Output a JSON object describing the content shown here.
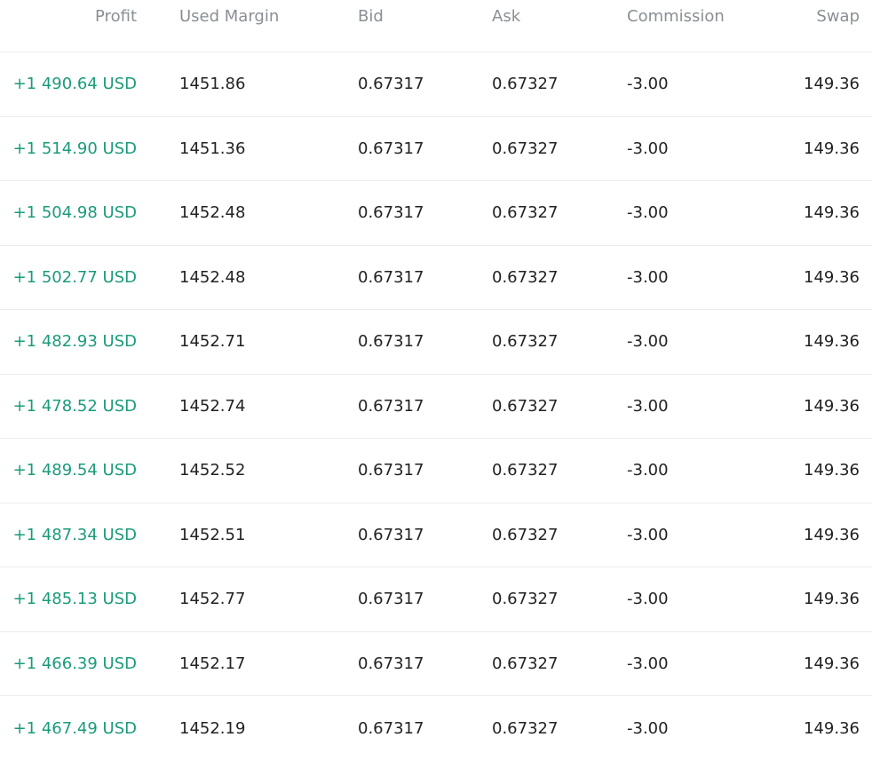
{
  "columns": {
    "profit": "Profit",
    "used_margin": "Used Margin",
    "bid": "Bid",
    "ask": "Ask",
    "commission": "Commission",
    "swap": "Swap"
  },
  "rows": [
    {
      "profit": "+1 490.64 USD",
      "used_margin": "1451.86",
      "bid": "0.67317",
      "ask": "0.67327",
      "commission": "-3.00",
      "swap": "149.36"
    },
    {
      "profit": "+1 514.90 USD",
      "used_margin": "1451.36",
      "bid": "0.67317",
      "ask": "0.67327",
      "commission": "-3.00",
      "swap": "149.36"
    },
    {
      "profit": "+1 504.98 USD",
      "used_margin": "1452.48",
      "bid": "0.67317",
      "ask": "0.67327",
      "commission": "-3.00",
      "swap": "149.36"
    },
    {
      "profit": "+1 502.77 USD",
      "used_margin": "1452.48",
      "bid": "0.67317",
      "ask": "0.67327",
      "commission": "-3.00",
      "swap": "149.36"
    },
    {
      "profit": "+1 482.93 USD",
      "used_margin": "1452.71",
      "bid": "0.67317",
      "ask": "0.67327",
      "commission": "-3.00",
      "swap": "149.36"
    },
    {
      "profit": "+1 478.52 USD",
      "used_margin": "1452.74",
      "bid": "0.67317",
      "ask": "0.67327",
      "commission": "-3.00",
      "swap": "149.36"
    },
    {
      "profit": "+1 489.54 USD",
      "used_margin": "1452.52",
      "bid": "0.67317",
      "ask": "0.67327",
      "commission": "-3.00",
      "swap": "149.36"
    },
    {
      "profit": "+1 487.34 USD",
      "used_margin": "1452.51",
      "bid": "0.67317",
      "ask": "0.67327",
      "commission": "-3.00",
      "swap": "149.36"
    },
    {
      "profit": "+1 485.13 USD",
      "used_margin": "1452.77",
      "bid": "0.67317",
      "ask": "0.67327",
      "commission": "-3.00",
      "swap": "149.36"
    },
    {
      "profit": "+1 466.39 USD",
      "used_margin": "1452.17",
      "bid": "0.67317",
      "ask": "0.67327",
      "commission": "-3.00",
      "swap": "149.36"
    },
    {
      "profit": "+1 467.49 USD",
      "used_margin": "1452.19",
      "bid": "0.67317",
      "ask": "0.67327",
      "commission": "-3.00",
      "swap": "149.36"
    }
  ],
  "colors": {
    "profit_positive": "#1a9b7b",
    "header_text": "#8a8f94",
    "row_divider": "#e9ecef"
  }
}
